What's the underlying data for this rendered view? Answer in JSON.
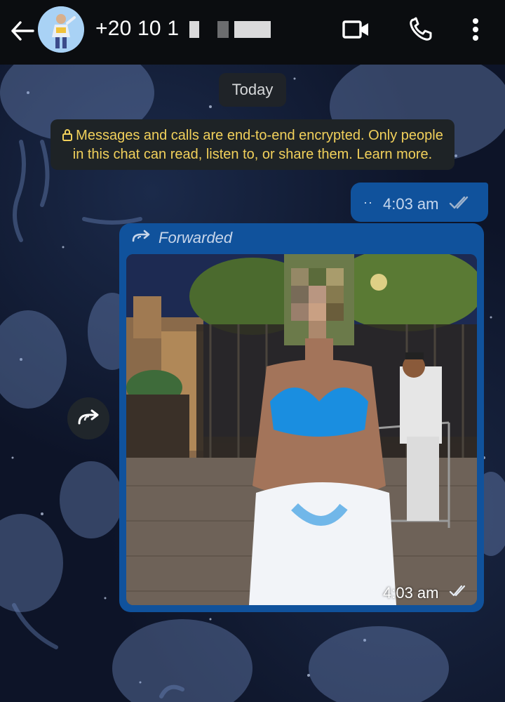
{
  "header": {
    "contact_name": "+20 10 1",
    "icons": [
      "back-arrow-icon",
      "avatar",
      "video-call-icon",
      "voice-call-icon",
      "more-vertical-icon"
    ]
  },
  "chat": {
    "date_label": "Today",
    "encryption_notice": "Messages and calls are end-to-end encrypted. Only people in this chat can read, listen to, or share them. Learn more.",
    "outgoing_small": {
      "prefix": "··",
      "time": "4:03 am",
      "status": "read"
    },
    "forwarded_message": {
      "label": "Forwarded",
      "time": "4:03 am",
      "status": "read"
    }
  },
  "colors": {
    "header_bg": "#0b0d10",
    "bubble_outgoing": "#10529c",
    "notice_text": "#f2d15b",
    "system_pill_bg": "#1e2326",
    "tick_color": "#9fb3cc"
  }
}
